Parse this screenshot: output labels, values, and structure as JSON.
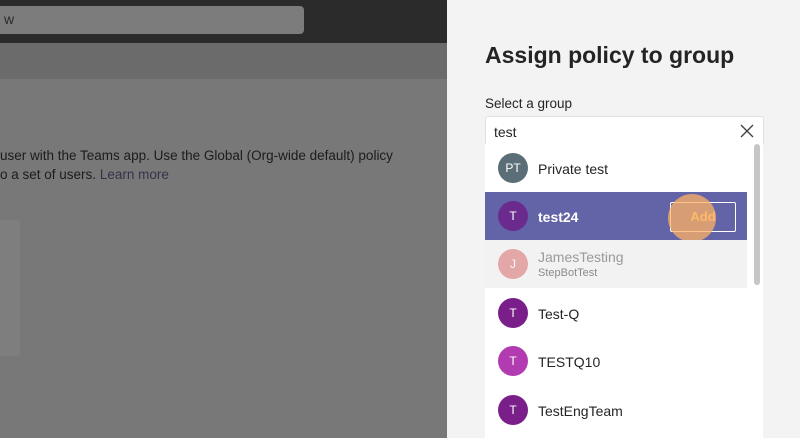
{
  "background": {
    "search_placeholder_fragment": "w",
    "description_line1": "user with the Teams app. Use the Global (Org-wide default) policy",
    "description_line2_prefix": "o a set of users.",
    "learn_more": "Learn more"
  },
  "panel": {
    "title": "Assign policy to group",
    "field_label": "Select a group",
    "search_value": "test",
    "results": [
      {
        "initials": "PT",
        "name": "Private test",
        "subtitle": "",
        "avatar_color": "#5b6e78",
        "state": "normal"
      },
      {
        "initials": "T",
        "name": "test24",
        "subtitle": "",
        "avatar_color": "#6b2a8e",
        "state": "selected"
      },
      {
        "initials": "J",
        "name": "JamesTesting",
        "subtitle": "StepBotTest",
        "avatar_color": "#d96a6a",
        "state": "disabled"
      },
      {
        "initials": "T",
        "name": "Test-Q",
        "subtitle": "",
        "avatar_color": "#7a1f8a",
        "state": "normal"
      },
      {
        "initials": "T",
        "name": "TESTQ10",
        "subtitle": "",
        "avatar_color": "#b23bb1",
        "state": "normal"
      },
      {
        "initials": "T",
        "name": "TestEngTeam",
        "subtitle": "",
        "avatar_color": "#7a1f8a",
        "state": "normal"
      }
    ],
    "add_label": "Add"
  },
  "colors": {
    "accent": "#6264a7",
    "overlay": "#787878"
  },
  "icons": {
    "clear": "close-icon"
  }
}
